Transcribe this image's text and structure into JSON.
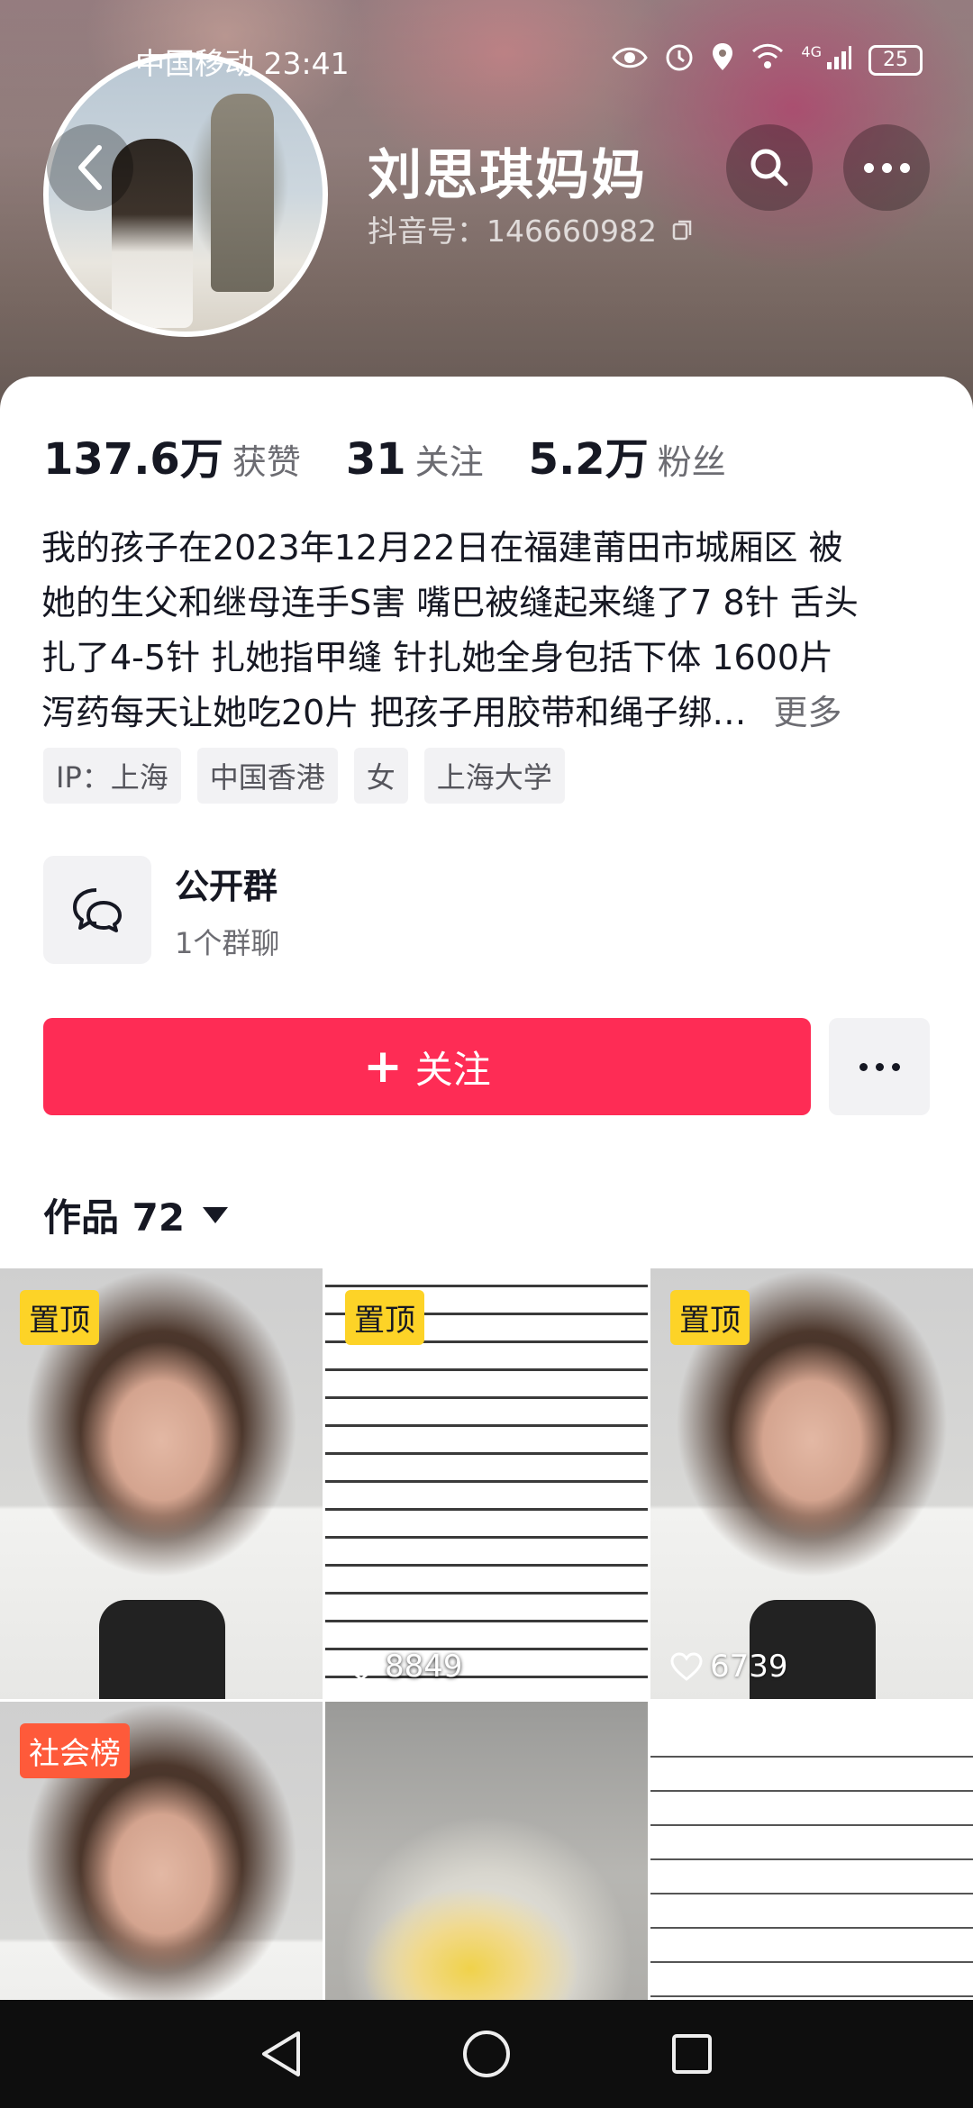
{
  "status_bar": {
    "carrier_time": "中国移动 23:41",
    "network": "4G",
    "battery": "25"
  },
  "profile": {
    "name": "刘思琪妈妈",
    "douyin_id": "抖音号：146660982"
  },
  "stats": [
    {
      "value": "137.6万",
      "label": "获赞"
    },
    {
      "value": "31",
      "label": "关注"
    },
    {
      "value": "5.2万",
      "label": "粉丝"
    }
  ],
  "bio": {
    "lines": [
      "我的孩子在2023年12月22日在福建莆田市城厢区 被",
      "她的生父和继母连手S害 嘴巴被缝起来缝了7 8针 舌头",
      "扎了4-5针 扎她指甲缝 针扎她全身包括下体 1600片",
      "泻药每天让她吃20片 把孩子用胶带和绳子绑…"
    ],
    "more_label": "更多"
  },
  "tags": [
    "IP：上海",
    "中国香港",
    "女",
    "上海大学"
  ],
  "group": {
    "title": "公开群",
    "subtitle": "1个群聊"
  },
  "actions": {
    "follow_label": "关注"
  },
  "works": {
    "label": "作品 72"
  },
  "videos": [
    {
      "badge": "置顶",
      "badge_color": "#fdd327",
      "likes": ""
    },
    {
      "badge": "置顶",
      "badge_color": "#fdd327",
      "likes": "8849"
    },
    {
      "badge": "置顶",
      "badge_color": "#fdd327",
      "likes": "6739"
    },
    {
      "badge": "社会榜",
      "badge_color": "#fe5a3a",
      "likes": ""
    },
    {
      "badge": "",
      "badge_color": "",
      "likes": ""
    },
    {
      "badge": "",
      "badge_color": "",
      "likes": ""
    }
  ],
  "colors": {
    "follow_button": "#fe2c55",
    "pin_badge": "#fdd327",
    "rank_badge": "#fe5a3a"
  }
}
